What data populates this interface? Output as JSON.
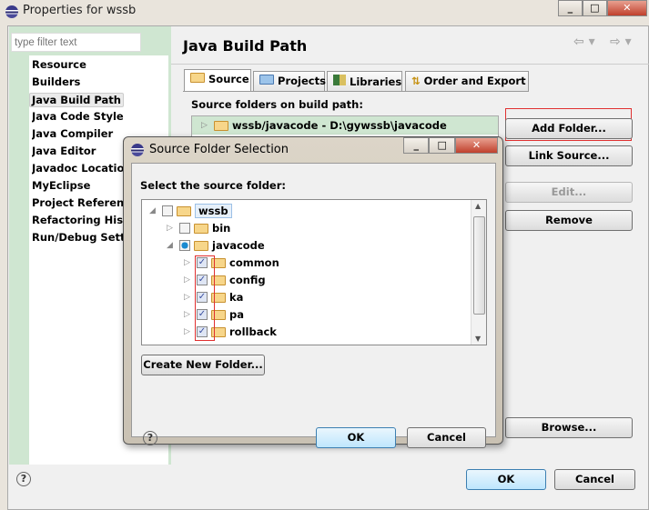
{
  "window": {
    "title": "Properties for wssb",
    "controls": [
      "_",
      "□",
      "✕"
    ]
  },
  "filter": {
    "placeholder": "type filter text"
  },
  "nav": [
    "Resource",
    "Builders",
    "Java Build Path",
    "Java Code Style",
    "Java Compiler",
    "Java Editor",
    "Javadoc Location",
    "MyEclipse",
    "Project References",
    "Refactoring History",
    "Run/Debug Settings"
  ],
  "nav_selected": "Java Build Path",
  "page": {
    "title": "Java Build Path",
    "tabs": [
      "Source",
      "Projects",
      "Libraries",
      "Order and Export"
    ],
    "active_tab": "Source",
    "source_label": "Source folders on build path:",
    "source_entry": "wssb/javacode - D:\\gywssb\\javacode",
    "buttons": {
      "add_folder": "Add Folder...",
      "link_source": "Link Source...",
      "edit": "Edit...",
      "remove": "Remove",
      "browse": "Browse..."
    }
  },
  "footer": {
    "ok": "OK",
    "cancel": "Cancel",
    "help": "?"
  },
  "dialog": {
    "title": "Source Folder Selection",
    "label": "Select the source folder:",
    "tree": [
      {
        "label": "wssb",
        "level": 0,
        "expanded": true,
        "check": "none"
      },
      {
        "label": "bin",
        "level": 1,
        "expanded": false,
        "check": "none"
      },
      {
        "label": "javacode",
        "level": 1,
        "expanded": true,
        "check": "partial"
      },
      {
        "label": "common",
        "level": 2,
        "expanded": false,
        "check": "checked"
      },
      {
        "label": "config",
        "level": 2,
        "expanded": false,
        "check": "checked"
      },
      {
        "label": "ka",
        "level": 2,
        "expanded": false,
        "check": "checked"
      },
      {
        "label": "pa",
        "level": 2,
        "expanded": false,
        "check": "checked"
      },
      {
        "label": "rollback",
        "level": 2,
        "expanded": false,
        "check": "checked"
      }
    ],
    "create_folder": "Create New Folder...",
    "ok": "OK",
    "cancel": "Cancel",
    "help": "?"
  }
}
